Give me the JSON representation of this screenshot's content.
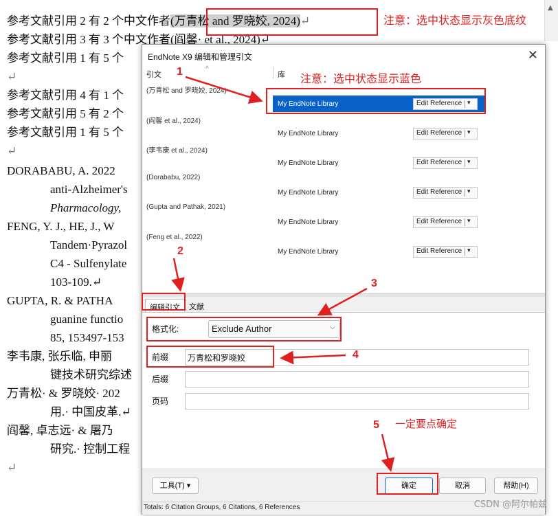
{
  "document": {
    "lines": [
      {
        "pre": "参考文献引用 2 有 2 个中文作者",
        "sel": "(万青松  and  罗晓姣, 2024)",
        "post": "↵"
      },
      {
        "pre": "参考文献引用 3 有 3 个中文作者(阎馨· et al., 2024)↵"
      },
      {
        "pre": "参考文献引用 1 有 5 个"
      },
      {
        "pre": "↵"
      },
      {
        "pre": "参考文献引用 4 有 1 个"
      },
      {
        "pre": "参考文献引用 5 有 2 个"
      },
      {
        "pre": "参考文献引用 1 有 5 个"
      },
      {
        "pre": "↵"
      },
      {
        "pre": "DORABABU, A. 2022"
      },
      {
        "pre": "anti-Alzheimer's"
      },
      {
        "pre": "Pharmacology, "
      },
      {
        "pre": "FENG, Y. J., HE, J., W"
      },
      {
        "pre": "Tandem·Pyrazol"
      },
      {
        "pre": "C4 - Sulfenylate"
      },
      {
        "pre": "103-109.↵"
      },
      {
        "pre": "GUPTA, R. & PATHA"
      },
      {
        "pre": "guanine functio"
      },
      {
        "pre": "85, 153497-153"
      },
      {
        "pre": "李韦康, 张乐临, 申丽"
      },
      {
        "pre": "键技术研究综述"
      },
      {
        "pre": "万青松· & 罗晓姣· 202"
      },
      {
        "pre": "用.· 中国皮革.↵"
      },
      {
        "pre": "阎馨, 卓志远· & 屠乃"
      },
      {
        "pre": "研究.· 控制工程"
      },
      {
        "pre": "↵"
      }
    ]
  },
  "dialog": {
    "title": "EndNote X9 编辑和管理引文",
    "close": "✕",
    "columns": {
      "citation": "引文",
      "library": "库"
    },
    "rows": [
      {
        "citation": "(万青松 and 罗晓姣, 2024)",
        "library": "My EndNote Library",
        "action": "Edit Reference"
      },
      {
        "citation": "(阎馨 et al., 2024)",
        "library": "My EndNote Library",
        "action": "Edit Reference"
      },
      {
        "citation": "(李韦康 et al., 2024)",
        "library": "My EndNote Library",
        "action": "Edit Reference"
      },
      {
        "citation": "(Dorababu, 2022)",
        "library": "My EndNote Library",
        "action": "Edit Reference"
      },
      {
        "citation": "(Gupta and Pathak, 2021)",
        "library": "My EndNote Library",
        "action": "Edit Reference"
      },
      {
        "citation": "(Feng et al., 2022)",
        "library": "My EndNote Library",
        "action": "Edit Reference"
      }
    ],
    "tabs": {
      "edit": "编辑引文",
      "reference": "文献"
    },
    "form": {
      "format_label": "格式化:",
      "format_value": "Exclude Author",
      "prefix_label": "前缀",
      "prefix_value": "万青松和罗晓姣",
      "suffix_label": "后缀",
      "pages_label": "页码"
    },
    "buttons": {
      "tools": "工具(T)",
      "ok": "确定",
      "cancel": "取消",
      "help": "帮助(H)"
    },
    "status": "Totals: 6 Citation Groups, 6 Citations, 6 References"
  },
  "annotations": {
    "note1": "注意：选中状态显示灰色底纹",
    "note2": "注意：选中状态显示蓝色",
    "n1": "1",
    "n2": "2",
    "n3": "3",
    "n4": "4",
    "n5": "5",
    "n5_text": "一定要点确定"
  },
  "watermark": "CSDN @阿尔帕兹",
  "colors": {
    "selection_blue": "#0a62c9",
    "annotation_red": "#e02020",
    "selection_gray": "#d0d0d0"
  }
}
